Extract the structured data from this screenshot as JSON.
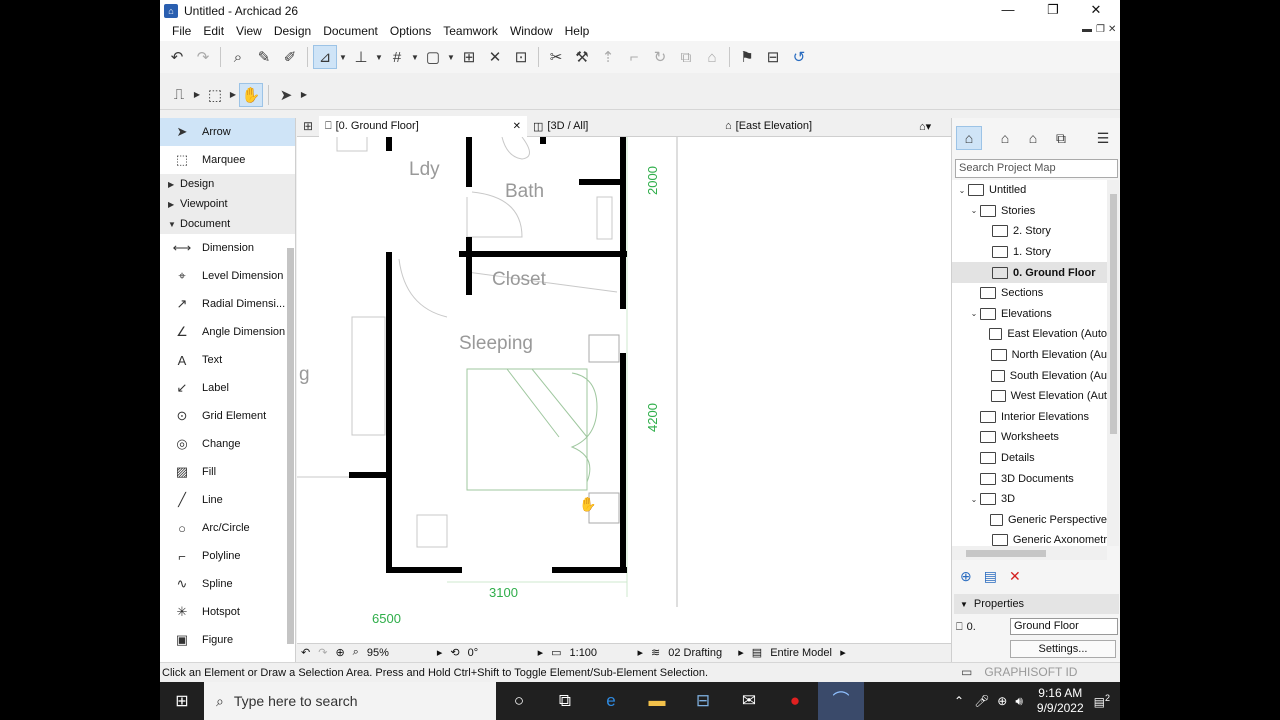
{
  "window": {
    "title": "Untitled - Archicad 26",
    "minimize": "—",
    "maximize": "❐",
    "close": "✕"
  },
  "menu": [
    "File",
    "Edit",
    "View",
    "Design",
    "Document",
    "Options",
    "Teamwork",
    "Window",
    "Help"
  ],
  "toolbox": {
    "top_tools": [
      {
        "label": "Arrow",
        "icon": "arrow-icon"
      },
      {
        "label": "Marquee",
        "icon": "marquee-icon"
      }
    ],
    "sections": [
      {
        "label": "Design",
        "expanded": false
      },
      {
        "label": "Viewpoint",
        "expanded": false
      },
      {
        "label": "Document",
        "expanded": true
      }
    ],
    "document_tools": [
      {
        "label": "Dimension",
        "icon": "dimension-icon"
      },
      {
        "label": "Level Dimension",
        "icon": "level-dimension-icon"
      },
      {
        "label": "Radial Dimensi...",
        "icon": "radial-dimension-icon"
      },
      {
        "label": "Angle Dimension",
        "icon": "angle-dimension-icon"
      },
      {
        "label": "Text",
        "icon": "text-icon"
      },
      {
        "label": "Label",
        "icon": "label-icon"
      },
      {
        "label": "Grid Element",
        "icon": "grid-element-icon"
      },
      {
        "label": "Change",
        "icon": "change-icon"
      },
      {
        "label": "Fill",
        "icon": "fill-icon"
      },
      {
        "label": "Line",
        "icon": "line-icon"
      },
      {
        "label": "Arc/Circle",
        "icon": "arc-circle-icon"
      },
      {
        "label": "Polyline",
        "icon": "polyline-icon"
      },
      {
        "label": "Spline",
        "icon": "spline-icon"
      },
      {
        "label": "Hotspot",
        "icon": "hotspot-icon"
      },
      {
        "label": "Figure",
        "icon": "figure-icon"
      }
    ]
  },
  "tabs": [
    {
      "label": "[0. Ground Floor]",
      "close": "✕"
    },
    {
      "label": "[3D / All]"
    },
    {
      "label": "[East Elevation]"
    }
  ],
  "plan": {
    "rooms": [
      "Ldy",
      "Bath",
      "Closet",
      "Sleeping"
    ],
    "dimensions": [
      "2000",
      "4200",
      "3100",
      "6500"
    ],
    "partial_label": "g"
  },
  "navbar": {
    "zoom": "95%",
    "angle": "0°",
    "scale": "1:100",
    "layer_combo": "02 Drafting",
    "model_view": "Entire Model"
  },
  "status": "Click an Element or Draw a Selection Area. Press and Hold Ctrl+Shift to Toggle Element/Sub-Element Selection.",
  "project_map": {
    "search_placeholder": "Search Project Map",
    "tree": [
      {
        "label": "Untitled",
        "level": 0,
        "toggle": "v"
      },
      {
        "label": "Stories",
        "level": 1,
        "toggle": "v"
      },
      {
        "label": "2. Story",
        "level": 2,
        "toggle": ""
      },
      {
        "label": "1. Story",
        "level": 2,
        "toggle": ""
      },
      {
        "label": "0. Ground Floor",
        "level": 2,
        "toggle": "",
        "selected": true
      },
      {
        "label": "Sections",
        "level": 1,
        "toggle": ""
      },
      {
        "label": "Elevations",
        "level": 1,
        "toggle": "v"
      },
      {
        "label": "East Elevation (Auto",
        "level": 2,
        "toggle": ""
      },
      {
        "label": "North Elevation (Au",
        "level": 2,
        "toggle": ""
      },
      {
        "label": "South Elevation (Au",
        "level": 2,
        "toggle": ""
      },
      {
        "label": "West Elevation (Aut",
        "level": 2,
        "toggle": ""
      },
      {
        "label": "Interior Elevations",
        "level": 1,
        "toggle": ""
      },
      {
        "label": "Worksheets",
        "level": 1,
        "toggle": ""
      },
      {
        "label": "Details",
        "level": 1,
        "toggle": ""
      },
      {
        "label": "3D Documents",
        "level": 1,
        "toggle": ""
      },
      {
        "label": "3D",
        "level": 1,
        "toggle": "v"
      },
      {
        "label": "Generic Perspective",
        "level": 2,
        "toggle": ""
      },
      {
        "label": "Generic Axonometr",
        "level": 2,
        "toggle": ""
      }
    ]
  },
  "properties": {
    "header": "Properties",
    "id": "0.",
    "name": "Ground Floor",
    "settings": "Settings..."
  },
  "brand": "GRAPHISOFT ID",
  "taskbar": {
    "search_placeholder": "Type here to search",
    "time": "9:16 AM",
    "date": "9/9/2022",
    "notif_count": "2"
  },
  "colors": {
    "accent": "#cfe4f7",
    "dimension_green": "#2fae4a",
    "wall": "#000000",
    "close_red": "#d42020"
  }
}
